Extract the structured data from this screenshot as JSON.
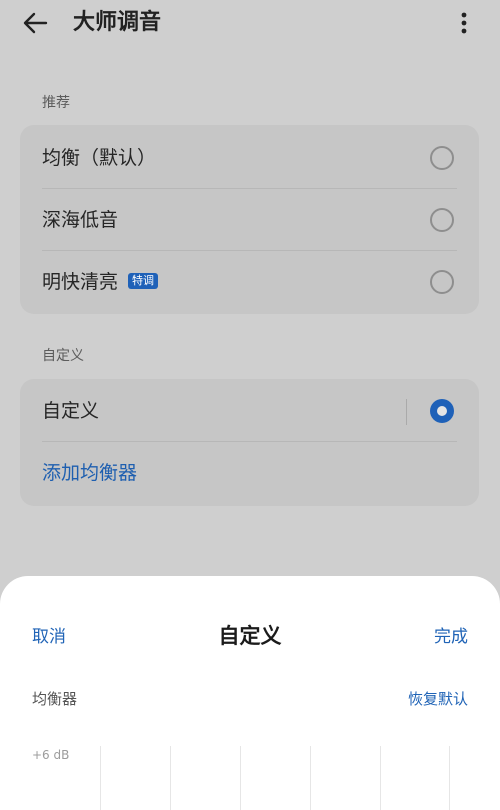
{
  "header": {
    "title": "大师调音",
    "back_icon": "arrow-left-icon",
    "more_icon": "more-vertical-icon"
  },
  "recommended": {
    "section_label": "推荐",
    "items": [
      {
        "label": "均衡（默认）",
        "selected": false
      },
      {
        "label": "深海低音",
        "selected": false
      },
      {
        "label": "明快清亮",
        "badge": "特调",
        "selected": false
      }
    ]
  },
  "custom": {
    "section_label": "自定义",
    "items": [
      {
        "label": "自定义",
        "selected": true
      }
    ],
    "add_label": "添加均衡器"
  },
  "sheet": {
    "cancel_label": "取消",
    "title": "自定义",
    "done_label": "完成",
    "eq_label": "均衡器",
    "reset_label": "恢复默认",
    "top_db_label": "+6 dB"
  },
  "colors": {
    "accent": "#1f61b8",
    "dim_background": "#cfcfcf",
    "card_background": "#c6c6c6",
    "sheet_background": "#ffffff"
  }
}
